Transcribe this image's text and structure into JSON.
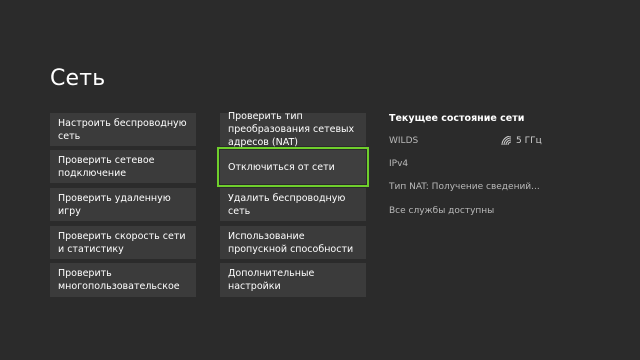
{
  "page": {
    "title": "Сеть"
  },
  "left_column": [
    {
      "label": "Настроить беспроводную сеть"
    },
    {
      "label": "Проверить сетевое подключение"
    },
    {
      "label": "Проверить удаленную игру"
    },
    {
      "label": "Проверить скорость сети и статистику"
    },
    {
      "label": "Проверить многопользовательское"
    }
  ],
  "middle_column": [
    {
      "label": "Проверить тип преобразования сетевых адресов (NAT)"
    },
    {
      "label": "Отключиться от сети"
    },
    {
      "label": "Удалить беспроводную сеть"
    },
    {
      "label": "Использование пропускной способности"
    },
    {
      "label": "Дополнительные настройки"
    }
  ],
  "status": {
    "title": "Текущее состояние сети",
    "network_name": "WILDS",
    "band": "5 ГГц",
    "ip_version": "IPv4",
    "nat_type": "Тип NAT: Получение сведений...",
    "services": "Все службы доступны"
  },
  "colors": {
    "background": "#2b2b2b",
    "tile": "#3b3b3b",
    "focus_accent": "#6fcf2c"
  },
  "icons": {
    "wifi": "wifi-signal-icon"
  }
}
